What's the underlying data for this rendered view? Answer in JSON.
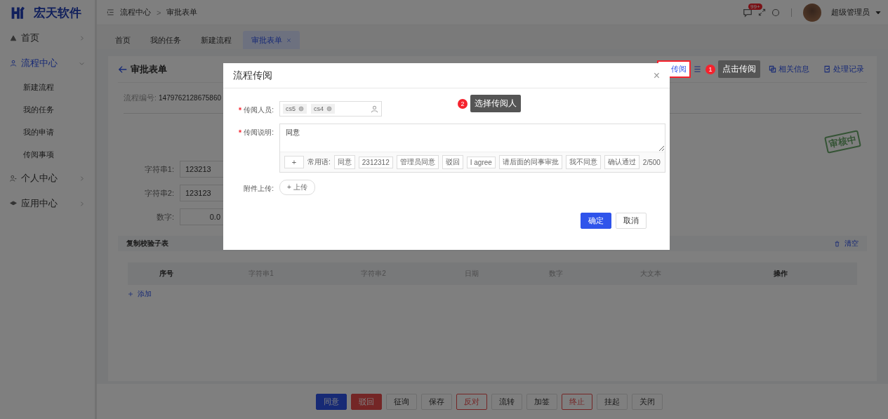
{
  "logo": {
    "text": "宏天软件"
  },
  "sidebar": {
    "items": [
      {
        "label": "首页",
        "expanded": false,
        "selected": false
      },
      {
        "label": "流程中心",
        "expanded": true,
        "selected": true,
        "children": [
          {
            "label": "新建流程"
          },
          {
            "label": "我的任务"
          },
          {
            "label": "我的申请"
          },
          {
            "label": "传阅事项"
          }
        ]
      },
      {
        "label": "个人中心",
        "expanded": false,
        "selected": false
      },
      {
        "label": "应用中心",
        "expanded": false,
        "selected": false
      }
    ]
  },
  "header": {
    "breadcrumb": [
      "流程中心",
      "审批表单"
    ],
    "separator": ">",
    "message_badge": "99+",
    "user": "超级管理员"
  },
  "tabs": [
    {
      "label": "首页",
      "selected": false
    },
    {
      "label": "我的任务",
      "selected": false
    },
    {
      "label": "新建流程",
      "selected": false
    },
    {
      "label": "审批表单",
      "selected": true,
      "closable": true
    }
  ],
  "form": {
    "title": "审批表单",
    "toolbar": [
      {
        "label": "传阅",
        "highlighted": true
      },
      {
        "highlighted": false
      },
      {
        "label": "相关信息",
        "highlighted": false
      },
      {
        "label": "处理记录",
        "highlighted": false
      }
    ],
    "flow_no_label": "流程编号:",
    "flow_no": "1479762128675860",
    "stamp": "审核中",
    "fields": [
      {
        "label": "字符串1:",
        "value": "123213",
        "kind": "text"
      },
      {
        "label": "字符串2:",
        "value": "123123",
        "kind": "text"
      },
      {
        "label": "数字:",
        "value": "0.0",
        "kind": "number"
      }
    ],
    "subtable": {
      "title": "复制校验子表",
      "clear": "清空",
      "columns": [
        {
          "label": "序号",
          "bold": true
        },
        {
          "label": "字符串1",
          "bold": false
        },
        {
          "label": "字符串2",
          "bold": false
        },
        {
          "label": "日期",
          "bold": false
        },
        {
          "label": "数字",
          "bold": false
        },
        {
          "label": "大文本",
          "bold": false
        },
        {
          "label": "操作",
          "bold": true
        }
      ],
      "add": "添加"
    }
  },
  "actions": [
    {
      "label": "同意",
      "kind": "primary"
    },
    {
      "label": "驳回",
      "kind": "danger"
    },
    {
      "label": "征询",
      "kind": "default"
    },
    {
      "label": "保存",
      "kind": "default"
    },
    {
      "label": "反对",
      "kind": "danger-outline"
    },
    {
      "label": "流转",
      "kind": "default"
    },
    {
      "label": "加签",
      "kind": "default"
    },
    {
      "label": "终止",
      "kind": "danger-outline"
    },
    {
      "label": "挂起",
      "kind": "default"
    },
    {
      "label": "关闭",
      "kind": "default"
    }
  ],
  "guide": [
    {
      "step": "1",
      "text": "点击传阅"
    },
    {
      "step": "2",
      "text": "选择传阅人"
    }
  ],
  "dialog": {
    "title": "流程传阅",
    "close": "×",
    "people_label": "传阅人员:",
    "people": [
      "cs5",
      "cs4"
    ],
    "note_label": "传阅说明:",
    "note": "同意",
    "add": "+",
    "phrases_label": "常用语:",
    "phrases": [
      "同意",
      "2312312",
      "管理员同意",
      "驳回",
      "I agree",
      "请后面的同事审批",
      "我不同意",
      "确认通过"
    ],
    "count": "2/500",
    "upload_label": "附件上传:",
    "upload": "+ 上传",
    "buttons": [
      {
        "label": "确定",
        "kind": "primary"
      },
      {
        "label": "取消",
        "kind": "default"
      }
    ]
  }
}
